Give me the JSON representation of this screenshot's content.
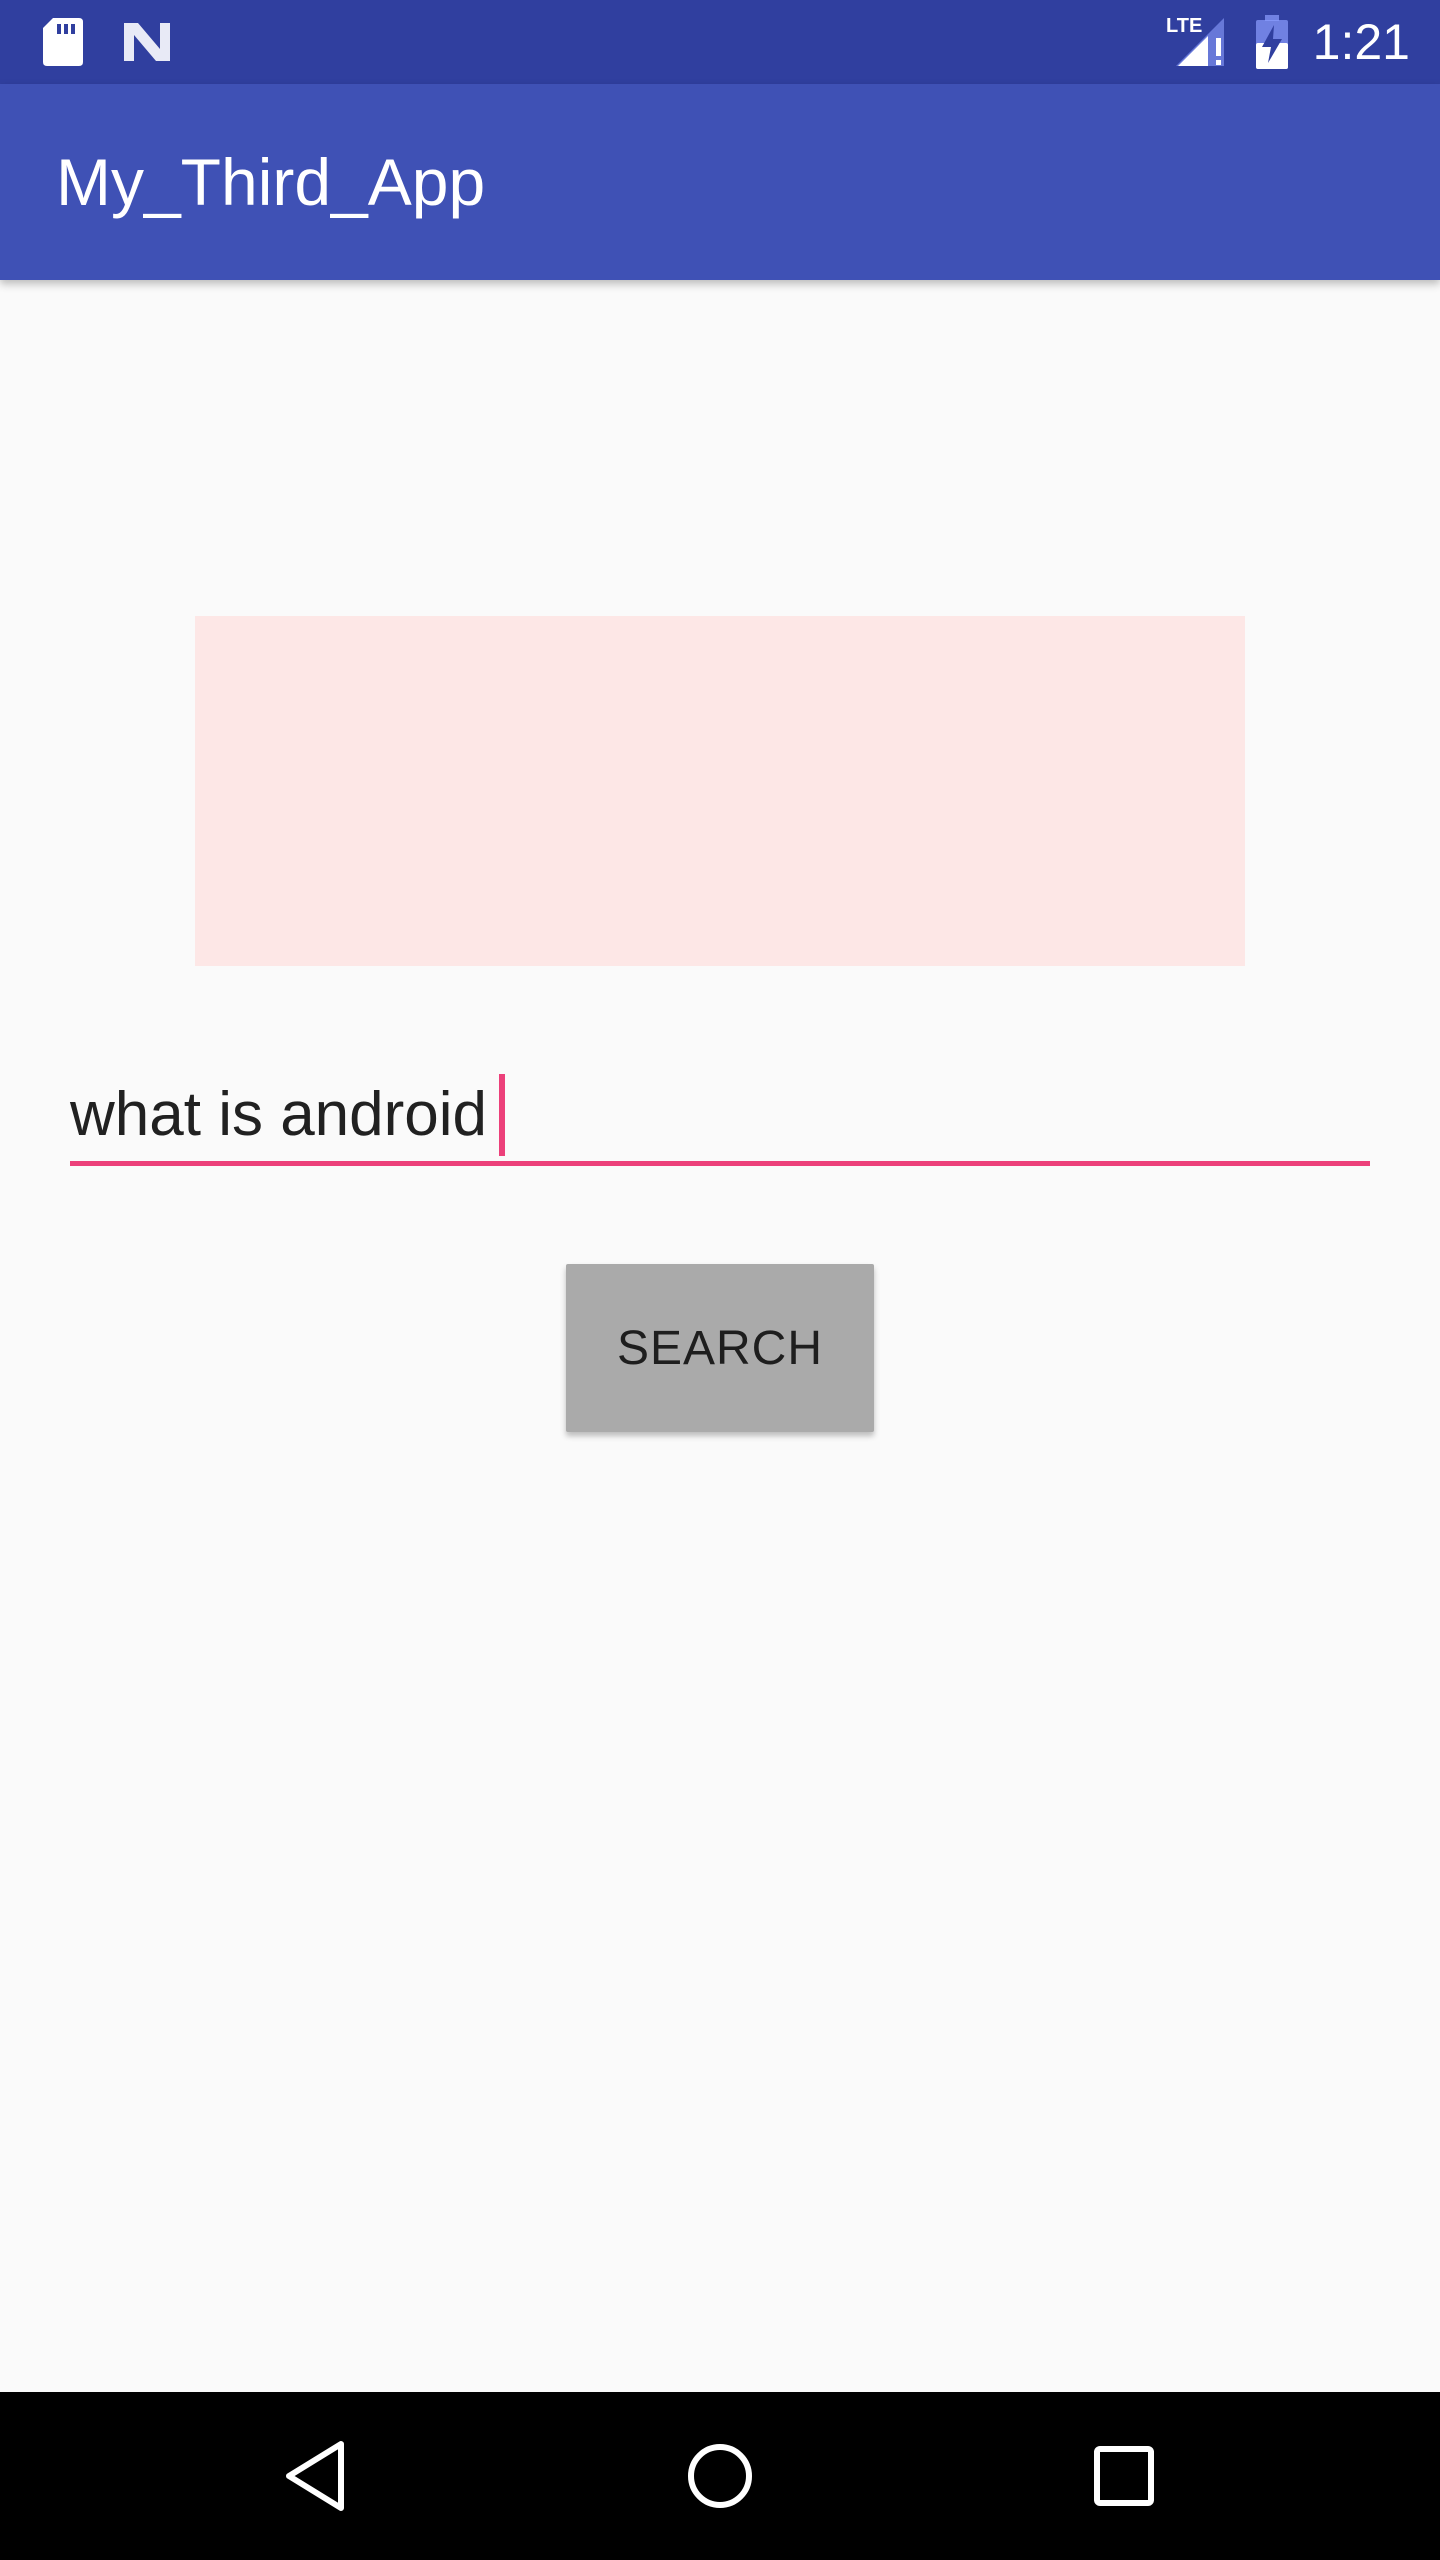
{
  "status_bar": {
    "time": "1:21",
    "network_label": "LTE",
    "icons": [
      "sd-card-icon",
      "n-logo-icon",
      "signal-lte-icon",
      "battery-charging-icon"
    ]
  },
  "app_bar": {
    "title": "My_Third_App"
  },
  "main": {
    "image_placeholder_color": "#FDE7E6",
    "search_input": {
      "value": "what is android"
    },
    "search_button": {
      "label": "SEARCH"
    }
  },
  "nav_bar": {
    "buttons": [
      "back-icon",
      "home-icon",
      "recents-icon"
    ]
  },
  "colors": {
    "status_bar": "#303F9F",
    "app_bar": "#3F51B5",
    "accent": "#EC407A",
    "background": "#FAFAFA",
    "button": "#AAAAAA"
  }
}
